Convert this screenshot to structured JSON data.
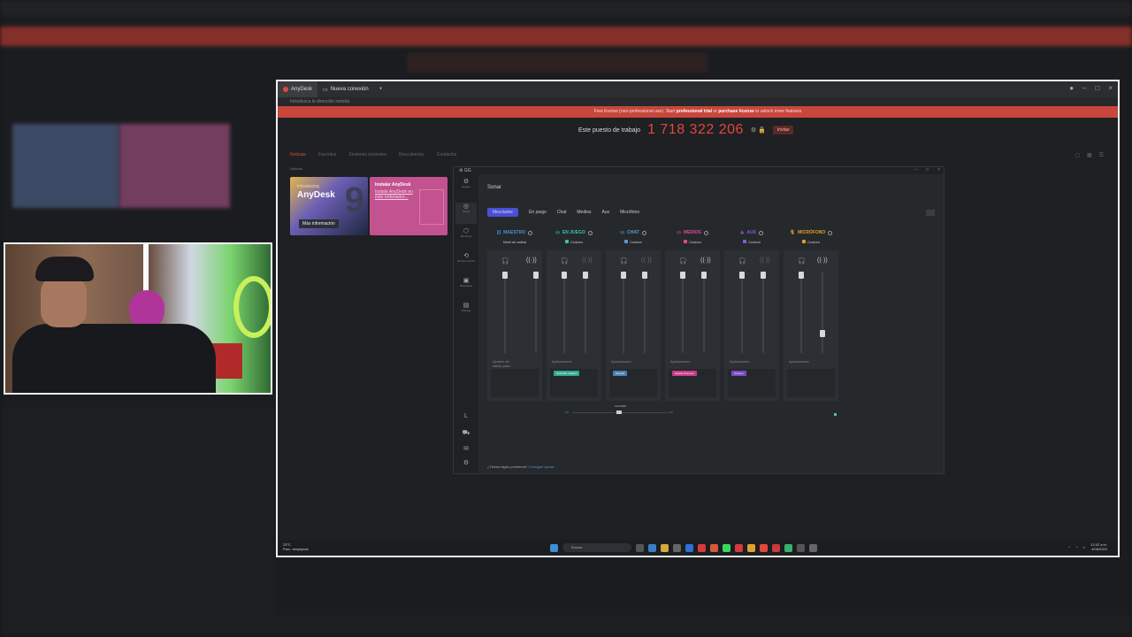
{
  "anydesk": {
    "tab_app": "AnyDesk",
    "tab_new": "Nueva conexión",
    "address_placeholder": "Introduzca la dirección remota",
    "banner_pre": "Free license (non-professional use). Start",
    "banner_trial": "professional trial",
    "banner_mid": "or",
    "banner_purchase": "purchase license",
    "banner_post": "to unlock more features",
    "workplace_label": "Este puesto de trabajo",
    "workplace_id": "1 718 322 206",
    "invite": "Invitar",
    "nav": [
      "Noticias",
      "Favoritos",
      "Sesiones recientes",
      "Descubiertos",
      "Contactos"
    ],
    "section_label": "Noticias",
    "card1_kicker": "Introducing",
    "card1_title": "AnyDesk",
    "card1_number": "9",
    "card1_more": "Más información",
    "card2_title": "Instalar AnyDesk",
    "card2_link": "Instale AnyDesk en este ordenador..."
  },
  "sonar": {
    "window_title": "GG",
    "header": "Sonar",
    "sidebar": [
      "Engine",
      "Sonar",
      "Moments",
      "3D arts Control",
      "Obsequios",
      "Noticias"
    ],
    "tabs": [
      "Mezclador",
      "En juego",
      "Chat",
      "Medios",
      "Aux",
      "Micrófono"
    ],
    "channels": [
      {
        "name": "MAESTRO",
        "sub": "Nivel de salida",
        "color": "#4a8fd6",
        "apps": "Ajustes de salida para transmisión",
        "chip": ""
      },
      {
        "name": "EN JUEGO",
        "sub": "Custom",
        "color": "#3fc1b0",
        "apps": "Aplicaciones",
        "chip": "WoW EN JUEGO"
      },
      {
        "name": "CHAT",
        "sub": "Custom",
        "color": "#5b9bd6",
        "apps": "Aplicaciones",
        "chip": "Discord"
      },
      {
        "name": "MEDIOS",
        "sub": "Custom",
        "color": "#e0499a",
        "apps": "Aplicaciones",
        "chip": "Spotify Premium"
      },
      {
        "name": "AUX",
        "sub": "Custom",
        "color": "#8a5ad6",
        "apps": "Aplicaciones",
        "chip": "Chrome"
      },
      {
        "name": "MICRÓFONO",
        "sub": "Custom",
        "color": "#e0a030",
        "apps": "Aplicaciones",
        "chip": ""
      }
    ],
    "chatmix_label": "CHATMIX",
    "help_text": "¿Tienes algún problema?",
    "help_link": "Consigue ayuda"
  },
  "taskbar": {
    "weather_temp": "23°C",
    "weather_desc": "Parc. despejado",
    "search_placeholder": "Buscar",
    "time": "12:42 a.m.",
    "date": "4/06/2024"
  },
  "colors": {
    "accent_red": "#e2473a",
    "sonar_blue": "#4a4fd4"
  }
}
